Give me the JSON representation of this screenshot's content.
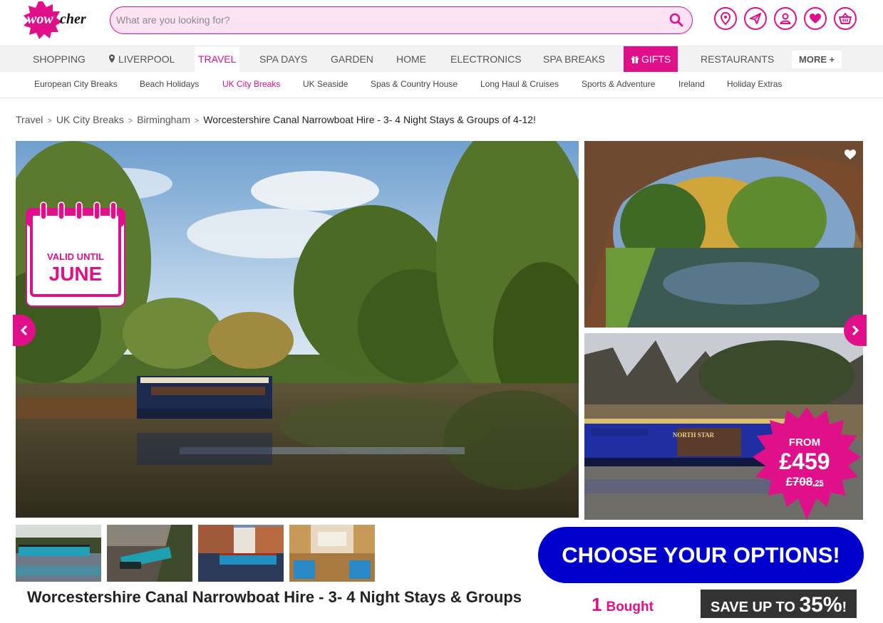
{
  "header": {
    "logo_text": "wowcher",
    "search_placeholder": "What are you looking for?"
  },
  "nav": {
    "items": [
      "SHOPPING",
      "LIVERPOOL",
      "TRAVEL",
      "SPA DAYS",
      "GARDEN",
      "HOME",
      "ELECTRONICS",
      "SPA BREAKS",
      "GIFTS",
      "RESTAURANTS"
    ],
    "more": "MORE +"
  },
  "subnav": {
    "items": [
      "European City Breaks",
      "Beach Holidays",
      "UK City Breaks",
      "UK Seaside",
      "Spas & Country House",
      "Long Haul & Cruises",
      "Sports & Adventure",
      "Ireland",
      "Holiday Extras"
    ]
  },
  "breadcrumb": {
    "items": [
      "Travel",
      "UK City Breaks",
      "Birmingham"
    ],
    "current": "Worcestershire Canal Narrowboat Hire - 3- 4 Night Stays & Groups of 4-12!"
  },
  "badge": {
    "line1": "VALID UNTIL",
    "line2": "JUNE"
  },
  "boat_name": "NORTH STAR",
  "price": {
    "from": "FROM",
    "amount": "£459",
    "original": "£708",
    "original_pence": ".25"
  },
  "cta": {
    "label": "CHOOSE YOUR OPTIONS!"
  },
  "deal": {
    "title": "Worcestershire Canal Narrowboat Hire - 3- 4 Night Stays & Groups",
    "bought_count": "1",
    "bought_label": "Bought",
    "save_label": "SAVE UP TO",
    "save_pct": "35%",
    "save_suffix": "!"
  },
  "colors": {
    "brand": "#e0108a",
    "cta": "#0000cc"
  }
}
